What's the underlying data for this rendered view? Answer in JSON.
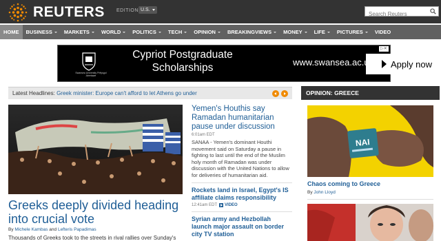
{
  "header": {
    "logo_text": "REUTERS",
    "edition_label": "EDITION:",
    "edition_value": "U.S.",
    "search_placeholder": "Search Reuters"
  },
  "nav": {
    "items": [
      {
        "label": "HOME",
        "has_menu": false,
        "active": true
      },
      {
        "label": "BUSINESS",
        "has_menu": true
      },
      {
        "label": "MARKETS",
        "has_menu": true
      },
      {
        "label": "WORLD",
        "has_menu": true
      },
      {
        "label": "POLITICS",
        "has_menu": true
      },
      {
        "label": "TECH",
        "has_menu": true
      },
      {
        "label": "OPINION",
        "has_menu": true
      },
      {
        "label": "BREAKINGVIEWS",
        "has_menu": true
      },
      {
        "label": "MONEY",
        "has_menu": true
      },
      {
        "label": "LIFE",
        "has_menu": true
      },
      {
        "label": "PICTURES",
        "has_menu": true
      },
      {
        "label": "VIDEO",
        "has_menu": false
      }
    ]
  },
  "ad": {
    "headline": "Cypriot Postgraduate Scholarships",
    "university": "Swansea University Prifysgol Abertawe",
    "url": "www.swansea.ac.uk",
    "cta": "Apply now"
  },
  "latest": {
    "label": "Latest Headlines:",
    "headline": "Greek minister: Europe can't afford to let Athens go under"
  },
  "lead": {
    "headline": "Greeks deeply divided heading into crucial vote",
    "byline_prefix": "By",
    "author1": "Michele Kambas",
    "byline_and": "and",
    "author2": "Lefteris Papadimas",
    "summary": "Thousands of Greeks took to the streets in rival rallies over Sunday's"
  },
  "stories": {
    "s1": {
      "headline": "Yemen's Houthis say Ramadan humanitarian pause under discussion",
      "time": "6:01am EDT",
      "body": "SANAA - Yemen's dominant Houthi movement said on Saturday a pause in fighting to last until the end of the Muslim holy month of Ramadan was under discussion with the United Nations to allow for deliveries of humanitarian aid."
    },
    "s2": {
      "headline": "Rockets land in Israel, Egypt's IS affiliate claims responsibility",
      "time": "12:41am EDT",
      "video_label": "VIDEO"
    },
    "s3": {
      "headline": "Syrian army and Hezbollah launch major assault on border city TV station"
    }
  },
  "opinion": {
    "header": "OPINION: GREECE",
    "title": "Chaos coming to Greece",
    "by_prefix": "By",
    "author": "John Lloyd"
  }
}
